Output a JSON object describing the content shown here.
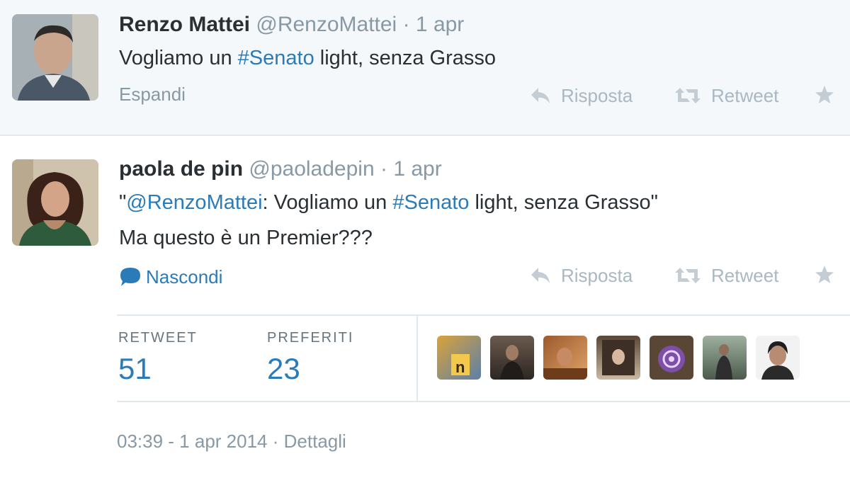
{
  "tweets": [
    {
      "fullname": "Renzo Mattei",
      "handle": "@RenzoMattei",
      "separator": "·",
      "date": "1 apr",
      "text": {
        "part1": "Vogliamo un ",
        "hashtag": "#Senato",
        "part2": " light, senza Grasso"
      },
      "expand_label": "Espandi",
      "actions": {
        "reply": "Risposta",
        "retweet": "Retweet"
      }
    },
    {
      "fullname": "paola de pin",
      "handle": "@paoladepin",
      "separator": "·",
      "date": "1 apr",
      "text": {
        "quote_open": "\"",
        "mention": "@RenzoMattei",
        "part1": ": Vogliamo un ",
        "hashtag": "#Senato",
        "part2": " light, senza Grasso\"",
        "line2": "Ma questo è un Premier???"
      },
      "hide_label": "Nascondi",
      "actions": {
        "reply": "Risposta",
        "retweet": "Retweet"
      },
      "stats": {
        "retweet_label": "RETWEET",
        "retweet_count": "51",
        "favorites_label": "PREFERITI",
        "favorites_count": "23"
      },
      "footer": {
        "time": "03:39 - 1 apr 2014",
        "separator": "·",
        "details": "Dettagli"
      }
    }
  ],
  "icons": {
    "reply": "reply-icon",
    "retweet": "retweet-icon",
    "favorite": "star-icon",
    "conversation": "speech-bubble-icon"
  },
  "colors": {
    "link": "#2b7bb9",
    "muted": "#8899a6",
    "action": "#aab8c2",
    "highlight_bg": "#f5f8fa"
  }
}
